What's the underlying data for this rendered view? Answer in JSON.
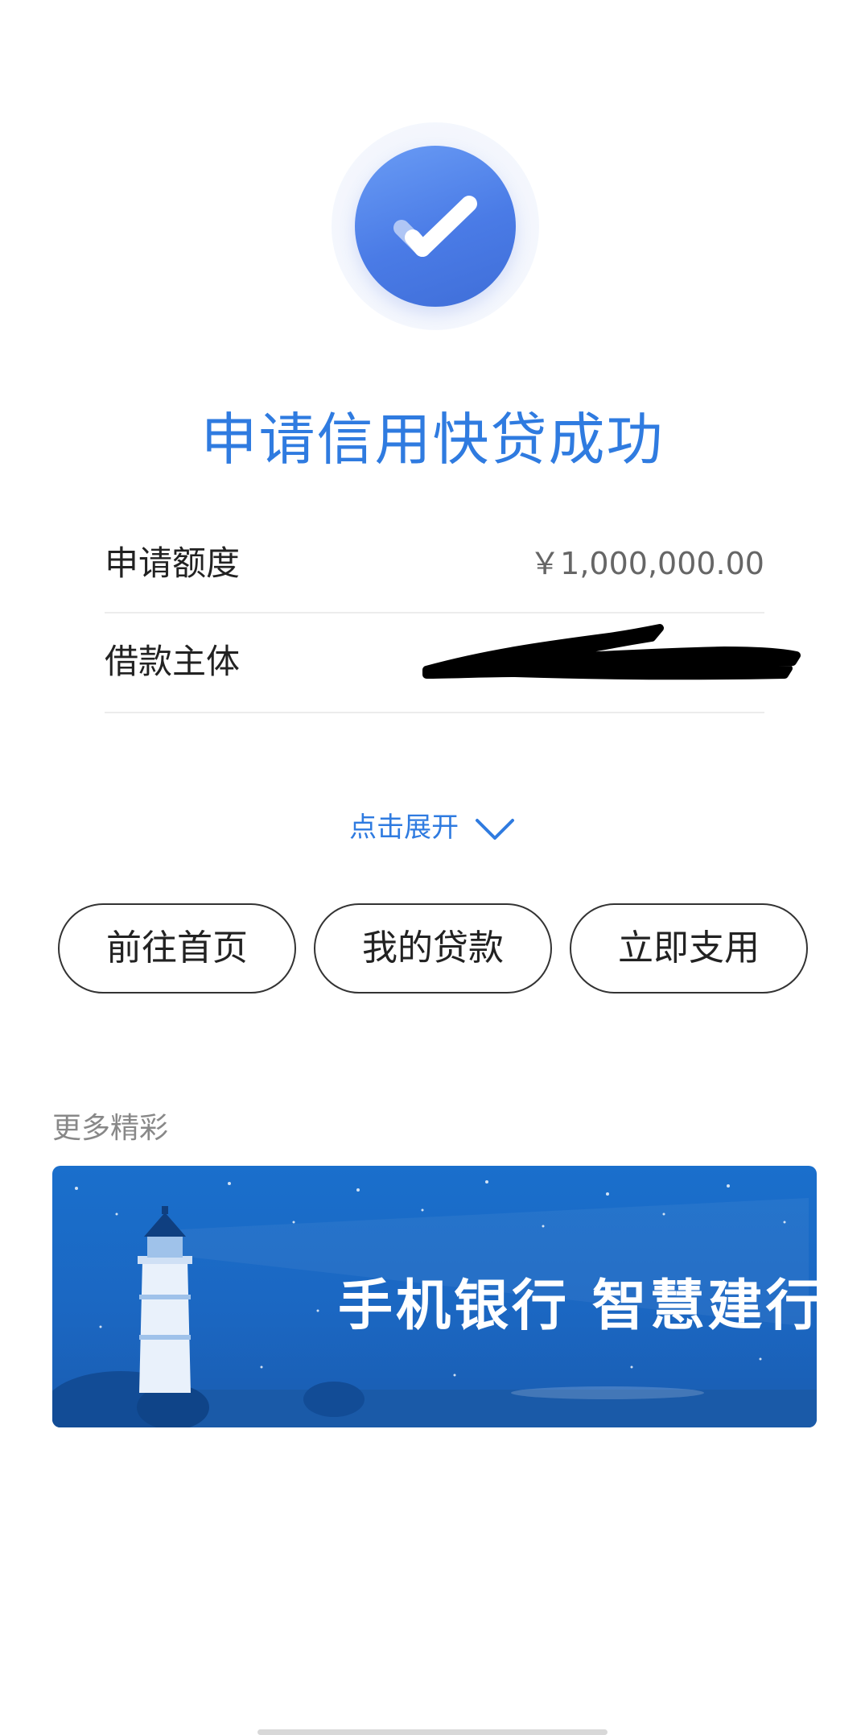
{
  "result": {
    "title": "申请信用快贷成功",
    "status_icon": "check-circle-icon",
    "accent_color": "#2f7be0"
  },
  "details": {
    "rows": [
      {
        "label": "申请额度",
        "value": "￥1,000,000.00"
      },
      {
        "label": "借款主体",
        "value": ""
      }
    ]
  },
  "expand": {
    "label": "点击展开",
    "icon": "chevron-down-icon"
  },
  "actions": {
    "home_label": "前往首页",
    "loans_label": "我的贷款",
    "use_label": "立即支用"
  },
  "more": {
    "title": "更多精彩",
    "banner_text": "手机银行  智慧建行"
  }
}
